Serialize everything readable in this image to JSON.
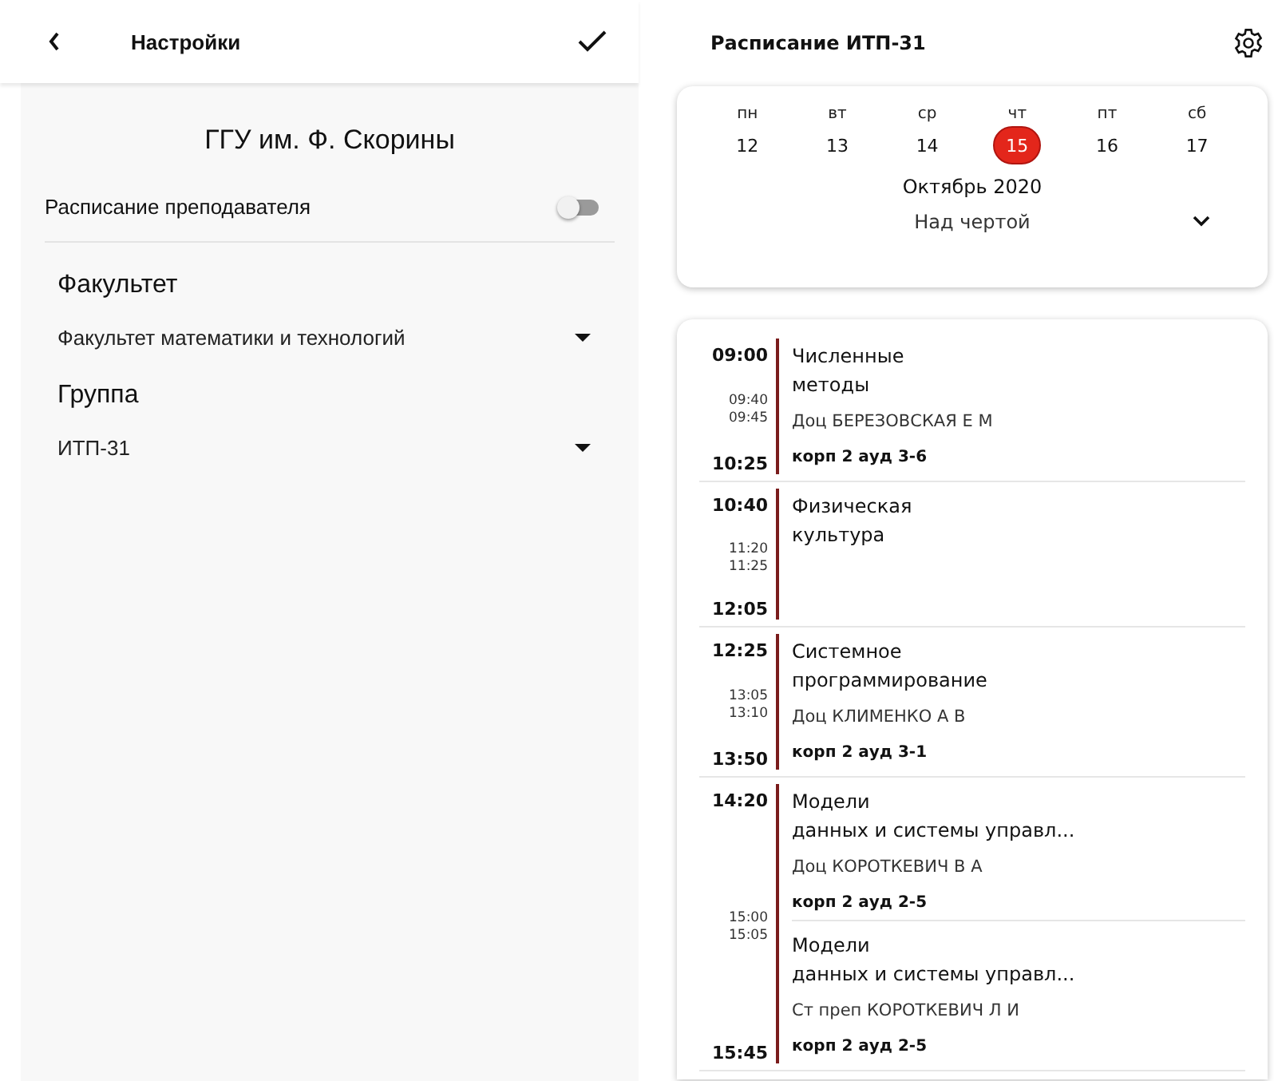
{
  "settings": {
    "title": "Настройки",
    "university": "ГГУ им. Ф. Скорины",
    "toggle": {
      "label": "Расписание преподавателя",
      "on": false
    },
    "fields": [
      {
        "label": "Факультет",
        "value": "Факультет математики и технологий"
      },
      {
        "label": "Группа",
        "value": "ИТП-31"
      }
    ]
  },
  "schedule": {
    "title": "Расписание ИТП-31",
    "calendar": {
      "days": [
        {
          "weekday": "пн",
          "date": "12",
          "selected": false
        },
        {
          "weekday": "вт",
          "date": "13",
          "selected": false
        },
        {
          "weekday": "ср",
          "date": "14",
          "selected": false
        },
        {
          "weekday": "чт",
          "date": "15",
          "selected": true
        },
        {
          "weekday": "пт",
          "date": "16",
          "selected": false
        },
        {
          "weekday": "сб",
          "date": "17",
          "selected": false
        }
      ],
      "month": "Октябрь 2020",
      "week": "Над чертой"
    },
    "pairs": [
      {
        "start": "09:00",
        "break_start": "09:40",
        "break_end": "09:45",
        "end": "10:25",
        "lessons": [
          {
            "title": "Численные\nметоды",
            "teacher": "Доц  БЕРЕЗОВСКАЯ Е М",
            "room": "корп 2 ауд 3-6"
          }
        ]
      },
      {
        "start": "10:40",
        "break_start": "11:20",
        "break_end": "11:25",
        "end": "12:05",
        "lessons": [
          {
            "title": "Физическая\nкультура"
          }
        ]
      },
      {
        "start": "12:25",
        "break_start": "13:05",
        "break_end": "13:10",
        "end": "13:50",
        "lessons": [
          {
            "title": "Системное\nпрограммирование",
            "teacher": "Доц  КЛИМЕНКО А В",
            "room": "корп 2 ауд 3-1"
          }
        ]
      },
      {
        "start": "14:20",
        "break_start": "15:00",
        "break_end": "15:05",
        "end": "15:45",
        "lessons": [
          {
            "title": "Модели\nданных и системы управл...",
            "teacher": "Доц  КОРОТКЕВИЧ В А",
            "room": "корп 2 ауд 2-5"
          },
          {
            "title": "Модели\nданных и системы управл...",
            "teacher": "Ст преп  КОРОТКЕВИЧ Л И",
            "room": "корп 2 ауд 2-5"
          }
        ]
      }
    ]
  }
}
